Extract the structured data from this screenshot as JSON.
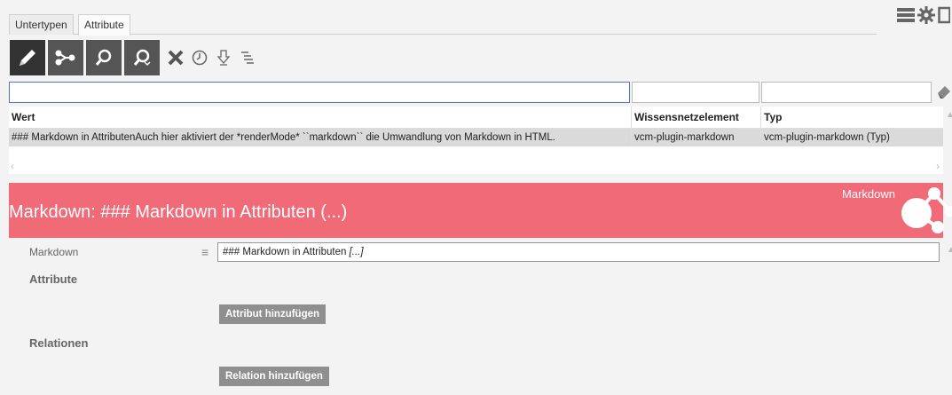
{
  "tabs": [
    {
      "label": "Untertypen"
    },
    {
      "label": "Attribute"
    }
  ],
  "top_icons": [
    "list-menu-icon",
    "gear-icon",
    "window-icon"
  ],
  "toolbar": {
    "buttons": [
      "edit-icon",
      "graph-icon",
      "search-icon",
      "search-advanced-icon"
    ],
    "icons": [
      "close-icon",
      "clock-icon",
      "download-icon",
      "tree-list-icon"
    ]
  },
  "filters": {
    "wert": "",
    "wissensnetzelement": "",
    "typ": ""
  },
  "table": {
    "columns": [
      "Wert",
      "Wissensnetzelement",
      "Typ"
    ],
    "rows": [
      {
        "wert": "### Markdown in AttributenAuch hier aktiviert der *renderMode* ``markdown`` die Umwandlung von Markdown in HTML.",
        "element": "vcm-plugin-markdown",
        "typ": "vcm-plugin-markdown (Typ)"
      }
    ]
  },
  "detail": {
    "title": "Markdown: ### Markdown in Attributen (...)",
    "type_label": "Markdown",
    "header_color": "#f06a77",
    "field_label": "Markdown",
    "field_value": "### Markdown in Attributen ",
    "field_ellipsis": "[...]",
    "section_attributes": "Attribute",
    "add_attribute": "Attribut hinzufügen",
    "section_relations": "Relationen",
    "add_relation": "Relation hinzufügen"
  }
}
